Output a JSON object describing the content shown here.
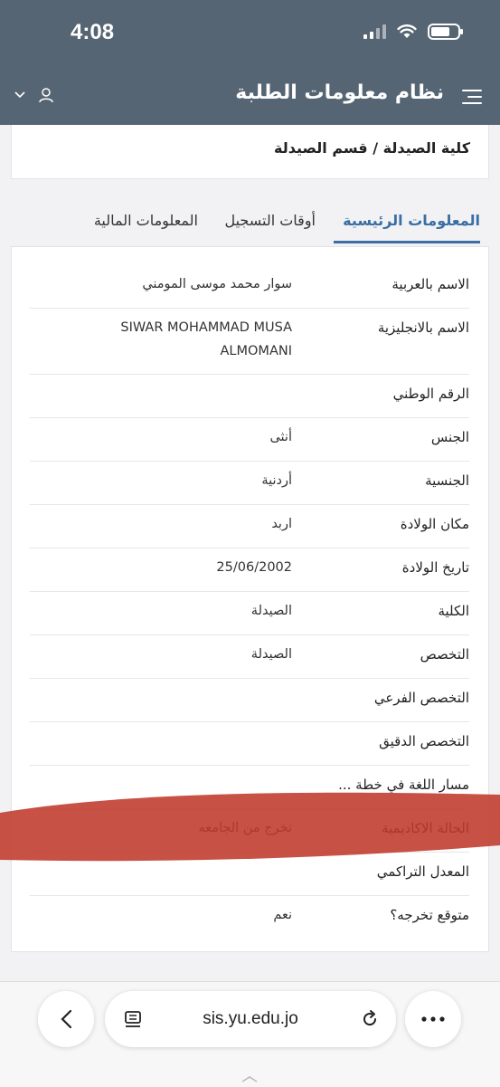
{
  "status": {
    "time": "4:08"
  },
  "header": {
    "title": "نظام معلومات الطلبة",
    "icons": [
      "hamburger-menu-icon",
      "user-icon",
      "chevron-down-icon"
    ]
  },
  "college": {
    "text": "كلية الصيدلة / قسم الصيدلة"
  },
  "tabs": [
    {
      "label": "المعلومات الرئيسية",
      "active": true
    },
    {
      "label": "أوقات التسجيل",
      "active": false
    },
    {
      "label": "المعلومات المالية",
      "active": false
    }
  ],
  "info": [
    {
      "key": "name-ar",
      "label": "الاسم بالعربية",
      "value": "سوار محمد موسى المومني"
    },
    {
      "key": "name-en",
      "label": "الاسم بالانجليزية",
      "value": "SIWAR MOHAMMAD MUSA ALMOMANI"
    },
    {
      "key": "national-id",
      "label": "الرقم الوطني",
      "value": ""
    },
    {
      "key": "gender",
      "label": "الجنس",
      "value": "أنثى"
    },
    {
      "key": "nationality",
      "label": "الجنسية",
      "value": "أردنية"
    },
    {
      "key": "birth-place",
      "label": "مكان الولادة",
      "value": "اربد"
    },
    {
      "key": "birth-date",
      "label": "تاريخ الولادة",
      "value": "25/06/2002"
    },
    {
      "key": "faculty",
      "label": "الكلية",
      "value": "الصيدلة"
    },
    {
      "key": "major",
      "label": "التخصص",
      "value": "الصيدلة"
    },
    {
      "key": "sub-major",
      "label": "التخصص الفرعي",
      "value": ""
    },
    {
      "key": "minor-specialty",
      "label": "التخصص الدقيق",
      "value": ""
    },
    {
      "key": "language-track",
      "label": "مسار اللغة في خطة ...",
      "value": ""
    },
    {
      "key": "academic-status",
      "label": "الحالة الاكاديمية",
      "value": "تخرج من الجامعه"
    },
    {
      "key": "gpa",
      "label": "المعدل التراكمي",
      "value": ""
    },
    {
      "key": "expected-graduation",
      "label": "متوقع تخرجه؟",
      "value": "نعم"
    }
  ],
  "browser": {
    "url": "sis.yu.edu.jo"
  },
  "colors": {
    "header": "#566573",
    "accent": "#3a6ea5",
    "redaction": "#c0392b"
  }
}
